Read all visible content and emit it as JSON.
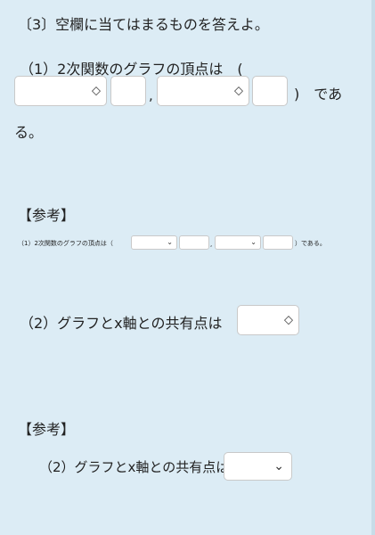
{
  "q3": {
    "heading": "〔3〕空欄に当てはまるものを答えよ。"
  },
  "q1": {
    "line1": "（1）2次関数のグラフの頂点は　(",
    "comma": ",",
    "close": ")　であ",
    "line2": "る。",
    "chevron": "◇"
  },
  "ref1": {
    "title": "【参考】",
    "prefix": "（1）2次関数のグラフの頂点は（",
    "comma": ",",
    "suffix": "）である。",
    "chevron": "⌄"
  },
  "q2": {
    "label": "（2）グラフとx軸との共有点は",
    "chevron": "◇"
  },
  "ref2": {
    "title": "【参考】",
    "label": "（2）グラフとx軸との共有点は",
    "chevron": "⌄"
  }
}
